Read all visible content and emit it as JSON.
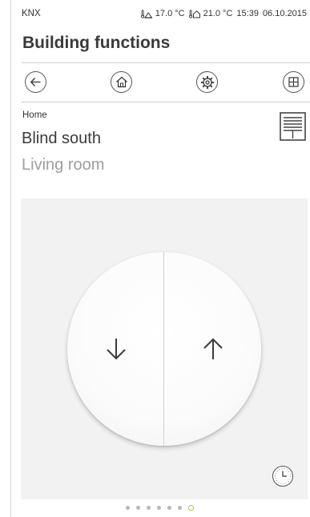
{
  "status_bar": {
    "brand": "KNX",
    "outdoor_temperature": "17.0 °C",
    "indoor_temperature": "21.0 °C",
    "time": "15:39",
    "date": "06.10.2015"
  },
  "page_title": "Building functions",
  "toolbar": {
    "buttons": [
      {
        "name": "back",
        "icon": "arrow-left-icon"
      },
      {
        "name": "home",
        "icon": "house-icon"
      },
      {
        "name": "settings",
        "icon": "gear-icon"
      },
      {
        "name": "rooms",
        "icon": "grid-icon"
      }
    ]
  },
  "breadcrumb": "Home",
  "device": {
    "title": "Blind south",
    "room": "Living room",
    "icon": "blind-icon"
  },
  "control": {
    "down_icon": "arrow-down-icon",
    "up_icon": "arrow-up-icon",
    "timer_icon": "clock-icon"
  },
  "pagination": {
    "total_pages": 7,
    "active_page": 7
  },
  "colors": {
    "accent": "#a8cc2f",
    "panel_background": "#f2f2f2",
    "secondary_text": "#9e9e9e"
  }
}
